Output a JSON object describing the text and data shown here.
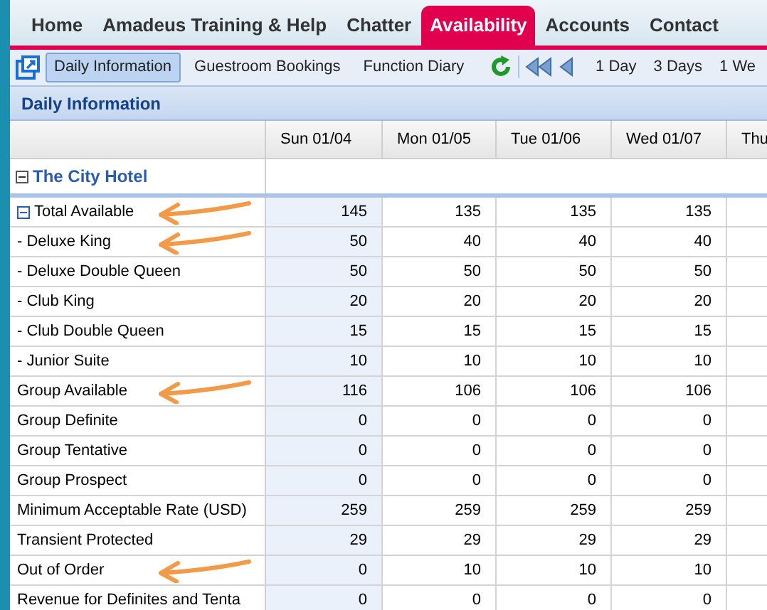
{
  "nav_tabs": [
    {
      "label": "Home",
      "selected": false
    },
    {
      "label": "Amadeus Training & Help",
      "selected": false
    },
    {
      "label": "Chatter",
      "selected": false
    },
    {
      "label": "Availability",
      "selected": true
    },
    {
      "label": "Accounts",
      "selected": false
    },
    {
      "label": "Contact",
      "selected": false
    }
  ],
  "toolbar": {
    "views": [
      {
        "label": "Daily Information",
        "selected": true
      },
      {
        "label": "Guestroom Bookings",
        "selected": false
      },
      {
        "label": "Function Diary",
        "selected": false
      }
    ],
    "ranges": [
      "1 Day",
      "3 Days",
      "1 We"
    ]
  },
  "section_title": "Daily Information",
  "table": {
    "columns": [
      {
        "label": "Sun 01/04",
        "highlighted": true
      },
      {
        "label": "Mon 01/05",
        "highlighted": false
      },
      {
        "label": "Tue 01/06",
        "highlighted": false
      },
      {
        "label": "Wed 01/07",
        "highlighted": false
      },
      {
        "label": "Thu",
        "highlighted": false
      }
    ],
    "hotel": {
      "name": "The City Hotel",
      "expanded": true
    },
    "rows": [
      {
        "label": "Total Available",
        "values": [
          "145",
          "135",
          "135",
          "135"
        ],
        "arrow": true,
        "expanded": true,
        "children": [
          {
            "label": "- Deluxe King",
            "values": [
              "50",
              "40",
              "40",
              "40"
            ],
            "arrow": true
          },
          {
            "label": "- Deluxe Double Queen",
            "values": [
              "50",
              "50",
              "50",
              "50"
            ],
            "arrow": false
          },
          {
            "label": "- Club King",
            "values": [
              "20",
              "20",
              "20",
              "20"
            ],
            "arrow": false
          },
          {
            "label": "- Club Double Queen",
            "values": [
              "15",
              "15",
              "15",
              "15"
            ],
            "arrow": false
          },
          {
            "label": "- Junior Suite",
            "values": [
              "10",
              "10",
              "10",
              "10"
            ],
            "arrow": false
          }
        ]
      },
      {
        "label": "Group Available",
        "values": [
          "116",
          "106",
          "106",
          "106"
        ],
        "arrow": true
      },
      {
        "label": "Group Definite",
        "values": [
          "0",
          "0",
          "0",
          "0"
        ],
        "arrow": false
      },
      {
        "label": "Group Tentative",
        "values": [
          "0",
          "0",
          "0",
          "0"
        ],
        "arrow": false
      },
      {
        "label": "Group Prospect",
        "values": [
          "0",
          "0",
          "0",
          "0"
        ],
        "arrow": false
      },
      {
        "label": "Minimum Acceptable Rate (USD)",
        "values": [
          "259",
          "259",
          "259",
          "259"
        ],
        "arrow": false
      },
      {
        "label": "Transient Protected",
        "values": [
          "29",
          "29",
          "29",
          "29"
        ],
        "arrow": false
      },
      {
        "label": "Out of Order",
        "values": [
          "0",
          "10",
          "10",
          "10"
        ],
        "arrow": true
      },
      {
        "label": "Revenue for Definites and Tenta",
        "values": [
          "0",
          "0",
          "0",
          "0"
        ],
        "arrow": false
      }
    ]
  }
}
